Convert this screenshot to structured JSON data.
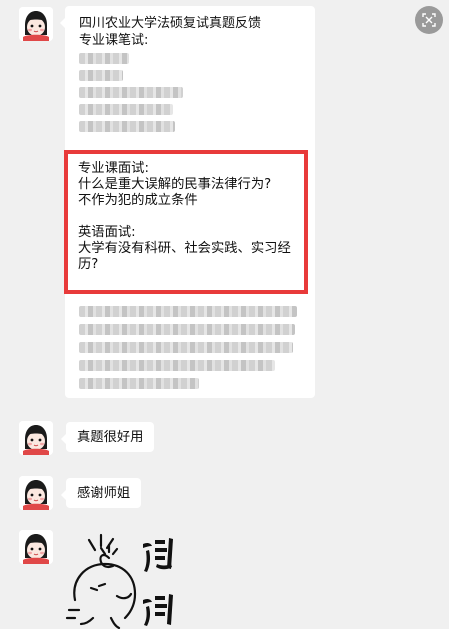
{
  "messages": {
    "first": {
      "title": "四川农业大学法硕复试真题反馈",
      "written_heading": "专业课笔试:",
      "interview_heading": "专业课面试:",
      "interview_q1": "什么是重大误解的民事法律行为?",
      "interview_q2": "不作为犯的成立条件",
      "english_heading": "英语面试:",
      "english_q1": "大学有没有科研、社会实践、实习经历?"
    },
    "second": "真题很好用",
    "third": "感谢师姐"
  },
  "colors": {
    "background": "#f0f0f0",
    "bubble": "#ffffff",
    "highlight": "#e83a3a"
  },
  "icons": {
    "corner": "screenshot-icon",
    "avatar": "cartoon-avatar",
    "sticker": "thanks-sticker"
  }
}
